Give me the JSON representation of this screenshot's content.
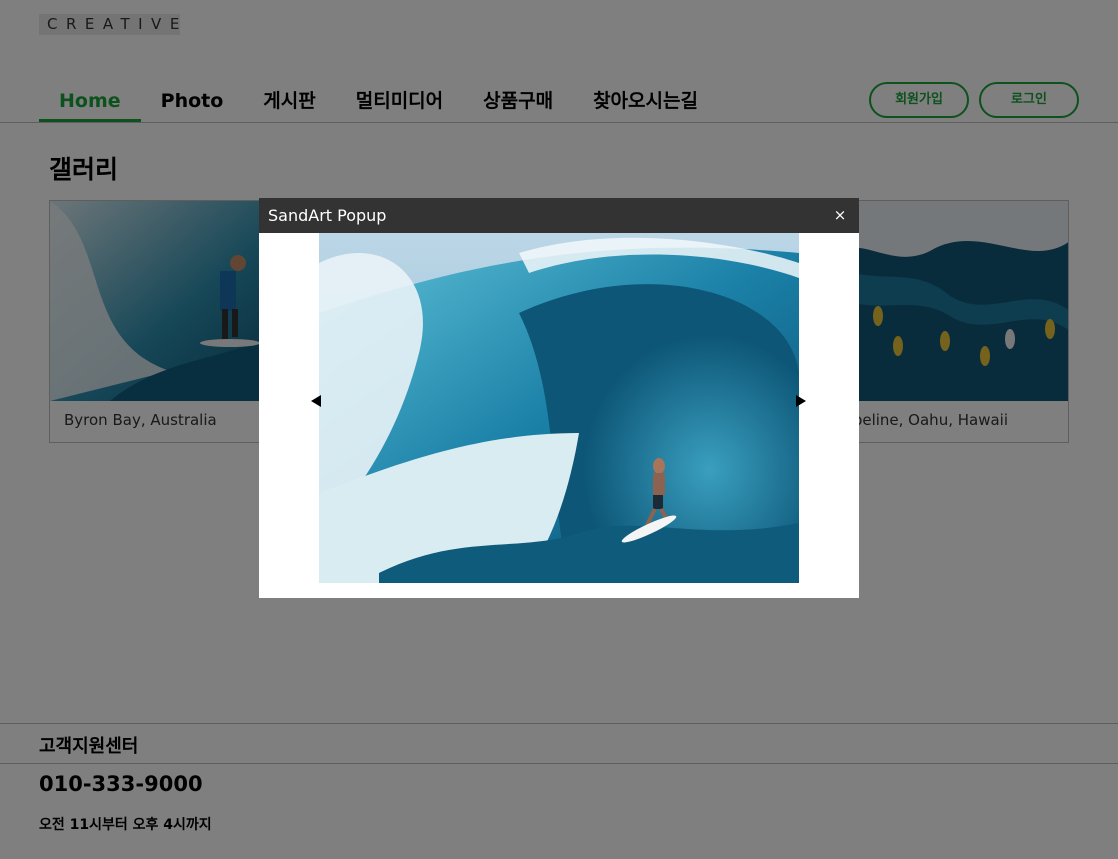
{
  "brand": {
    "logo_text": "CREATIVE"
  },
  "nav": {
    "items": [
      {
        "label": "Home",
        "active": true
      },
      {
        "label": "Photo"
      },
      {
        "label": "게시판"
      },
      {
        "label": "멀티미디어"
      },
      {
        "label": "상품구매"
      },
      {
        "label": "찾아오시는길"
      }
    ],
    "accent_color": "#1aa33b"
  },
  "auth": {
    "join_label": "회원가입",
    "login_label": "로그인"
  },
  "gallery": {
    "title": "갤러리",
    "cards": [
      {
        "caption": "Byron Bay, Australia"
      },
      {
        "caption": "peline, Oahu, Hawaii"
      }
    ]
  },
  "popup": {
    "title": "SandArt Popup",
    "close_glyph": "×",
    "prev_icon": "arrow-left-icon",
    "next_icon": "arrow-right-icon"
  },
  "footer": {
    "title": "고객지원센터",
    "phone": "010-333-9000",
    "hours": "오전 11시부터 오후 4시까지"
  }
}
